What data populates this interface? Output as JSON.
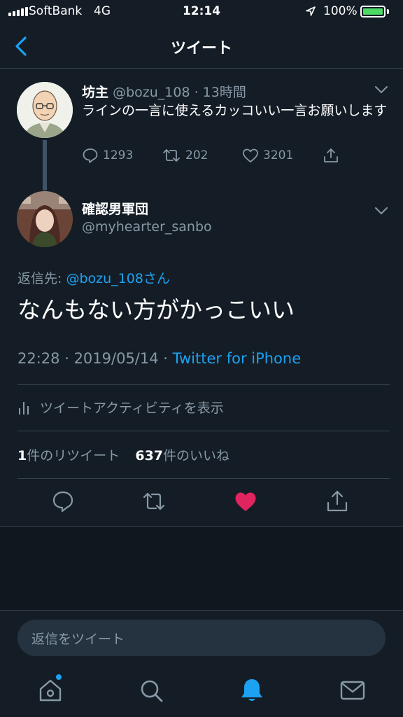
{
  "status_bar": {
    "carrier": "SoftBank",
    "network": "4G",
    "time": "12:14",
    "battery_percent": "100%",
    "battery_level": 1.0
  },
  "header": {
    "title": "ツイート"
  },
  "parent_tweet": {
    "name": "坊主",
    "handle": "@bozu_108",
    "separator": "·",
    "age": "13時間",
    "text": "ラインの一言に使えるカッコいい一言お願いします",
    "replies": "1293",
    "retweets": "202",
    "likes": "3201"
  },
  "main_tweet": {
    "name": "確認男軍団",
    "handle": "@myhearter_sanbo",
    "reply_prefix": "返信先: ",
    "reply_target": "@bozu_108さん",
    "text": "なんもない方がかっこいい",
    "time": "22:28",
    "separator": " · ",
    "date": "2019/05/14",
    "source": "Twitter for iPhone",
    "activity_label": "ツイートアクティビティを表示",
    "retweet_count": "1",
    "retweet_label": "件のリツイート",
    "like_count": "637",
    "like_label": "件のいいね"
  },
  "reply_box": {
    "placeholder": "返信をツイート"
  },
  "icons": {
    "back": "chevron-left-icon",
    "reply": "speech-bubble-icon",
    "retweet": "retweet-arrows-icon",
    "like": "heart-icon",
    "share": "share-upload-icon",
    "activity": "bar-chart-icon",
    "more": "chevron-down-icon",
    "tabs": [
      "home-icon",
      "search-icon",
      "bell-icon",
      "mail-icon"
    ]
  },
  "colors": {
    "background": "#141d26",
    "accent": "#1da1f2",
    "muted": "#8899a6",
    "like_active": "#e0245e"
  }
}
